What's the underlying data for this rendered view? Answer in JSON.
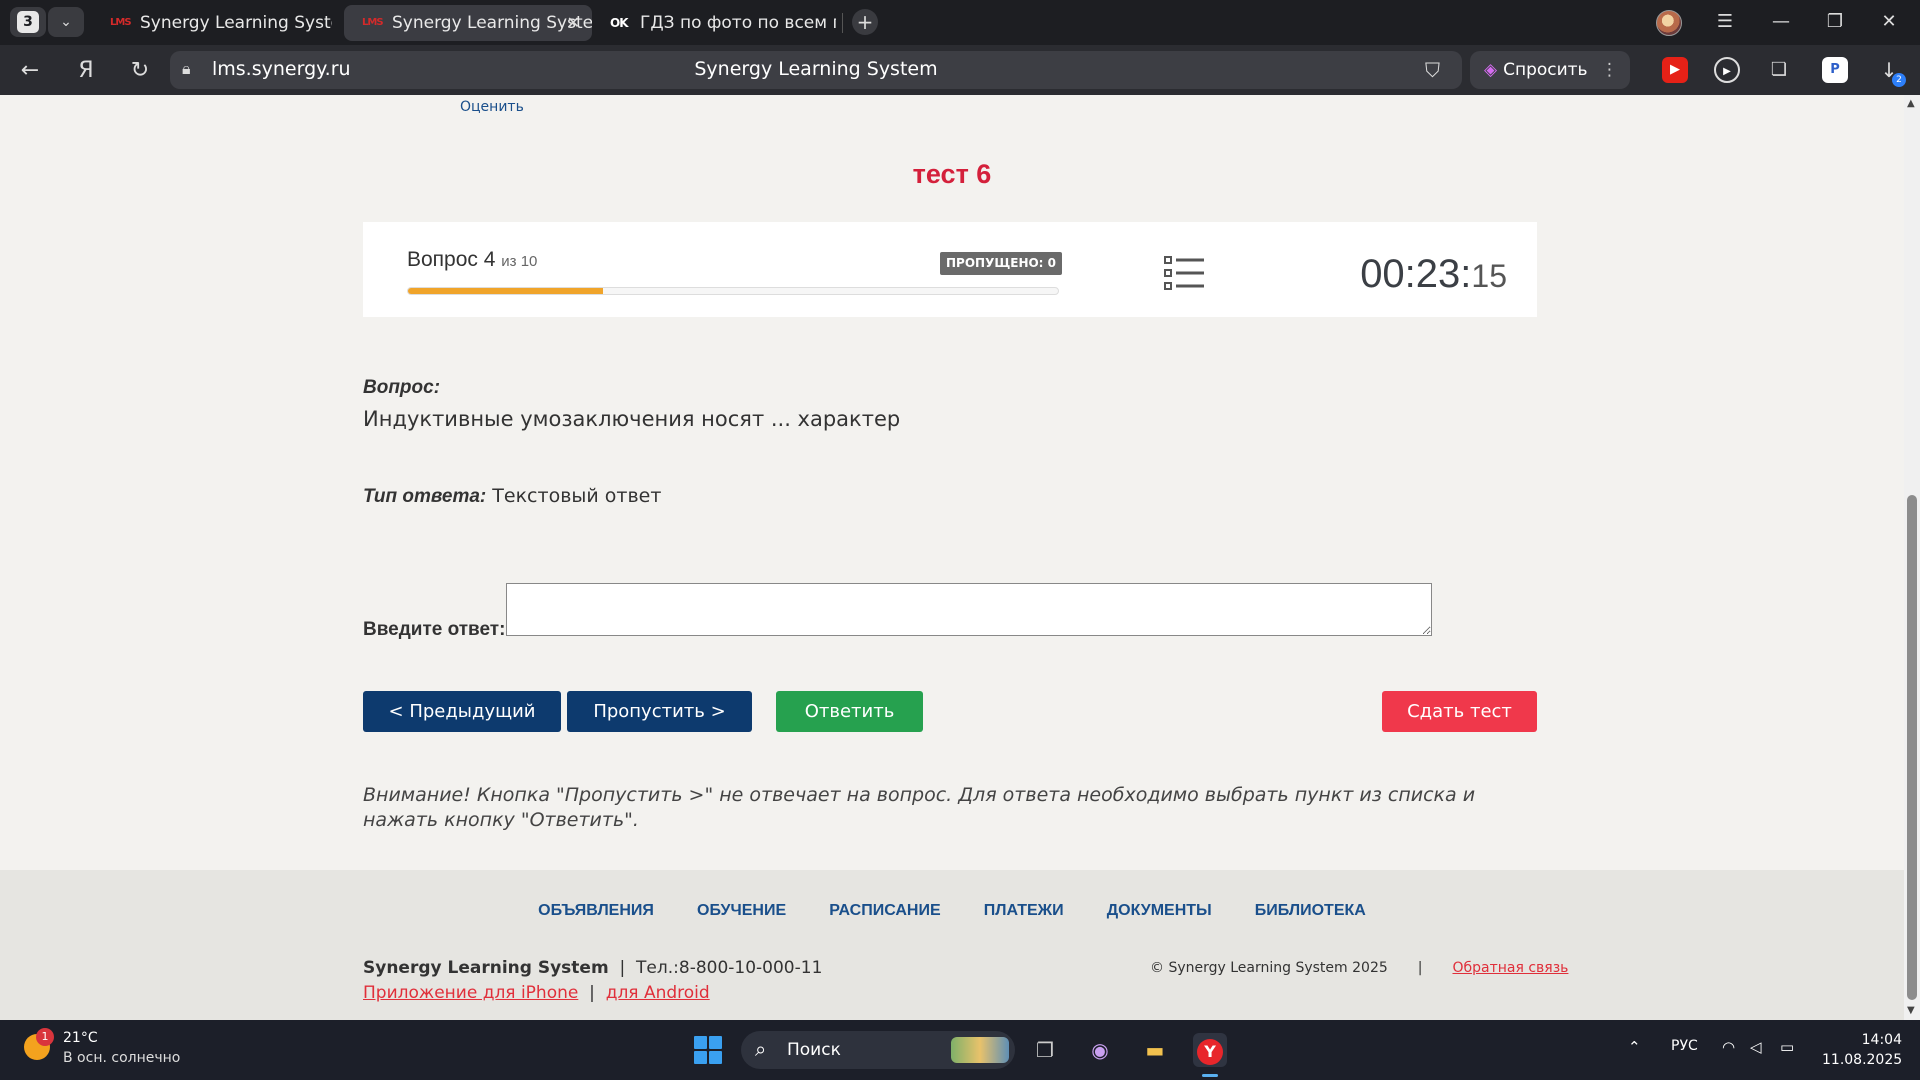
{
  "browser": {
    "tab_count": "3",
    "tabs": [
      {
        "favicon": "LMS",
        "title": "Synergy Learning System"
      },
      {
        "favicon": "LMS",
        "title": "Synergy Learning Syste"
      },
      {
        "favicon": "OK",
        "title": "ГДЗ по фото по всем пре"
      }
    ],
    "url": "lms.synergy.ru",
    "page_title": "Synergy Learning System",
    "ask_label": "Спросить",
    "download_badge": "2"
  },
  "page": {
    "rate_link": "Оценить",
    "test_title": "тест 6",
    "progress": {
      "question_label": "Вопрос 4",
      "total_label": "из 10",
      "skipped_label": "ПРОПУЩЕНО: 0",
      "fraction": 0.3,
      "timer_main": "00:23:",
      "timer_seconds": "15"
    },
    "question": {
      "label": "Вопрос:",
      "text": "Индуктивные умозаключения носят ... характер"
    },
    "answer_type": {
      "label": "Тип ответа:",
      "value": "Текстовый ответ"
    },
    "answer_input_label": "Введите ответ:",
    "answer_value": "",
    "buttons": {
      "prev": "< Предыдущий",
      "skip": "Пропустить >",
      "answer": "Ответить",
      "submit": "Сдать тест"
    },
    "notice": "Внимание! Кнопка \"Пропустить >\" не отвечает на вопрос. Для ответа необходимо выбрать пункт из списка и нажать кнопку \"Ответить\"."
  },
  "footer": {
    "nav": [
      "ОБЪЯВЛЕНИЯ",
      "ОБУЧЕНИЕ",
      "РАСПИСАНИЕ",
      "ПЛАТЕЖИ",
      "ДОКУМЕНТЫ",
      "БИБЛИОТЕКА"
    ],
    "brand": "Synergy Learning System",
    "phone": "Тел.:8-800-10-000-11",
    "app_iphone": "Приложение для iPhone",
    "app_android": "для Android",
    "copyright": "© Synergy Learning System 2025",
    "feedback": "Обратная связь"
  },
  "taskbar": {
    "weather_badge": "1",
    "temperature": "21°C",
    "weather_desc": "В осн. солнечно",
    "search_placeholder": "Поиск",
    "language": "РУС",
    "time": "14:04",
    "date": "11.08.2025"
  },
  "colors": {
    "accent_red": "#d4203b",
    "nav_blue": "#0d3a6e",
    "answer_green": "#26a14f",
    "submit_red": "#f0384b",
    "progress_orange": "#f0a42a"
  }
}
